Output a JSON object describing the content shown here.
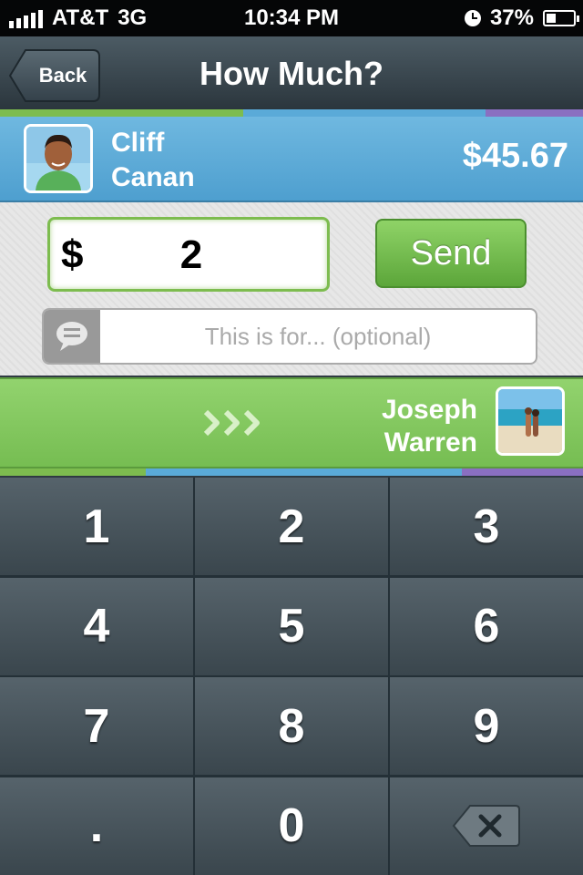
{
  "status_bar": {
    "carrier": "AT&T",
    "network": "3G",
    "time": "10:34 PM",
    "battery": "37%",
    "battery_level": 0.37
  },
  "navbar": {
    "back_label": "Back",
    "title": "How Much?"
  },
  "payer": {
    "first_name": "Cliff",
    "last_name": "Canan",
    "balance": "$45.67"
  },
  "amount_form": {
    "currency_symbol": "$",
    "amount_value": "2",
    "send_label": "Send",
    "memo_placeholder": "This is for... (optional)"
  },
  "payee": {
    "first_name": "Joseph",
    "last_name": "Warren"
  },
  "keypad": {
    "keys": [
      "1",
      "2",
      "3",
      "4",
      "5",
      "6",
      "7",
      "8",
      "9",
      ".",
      "0"
    ]
  },
  "colors": {
    "accent_green": "#7dbc4f",
    "accent_blue": "#5aaad8",
    "accent_purple": "#8a6fc1"
  }
}
